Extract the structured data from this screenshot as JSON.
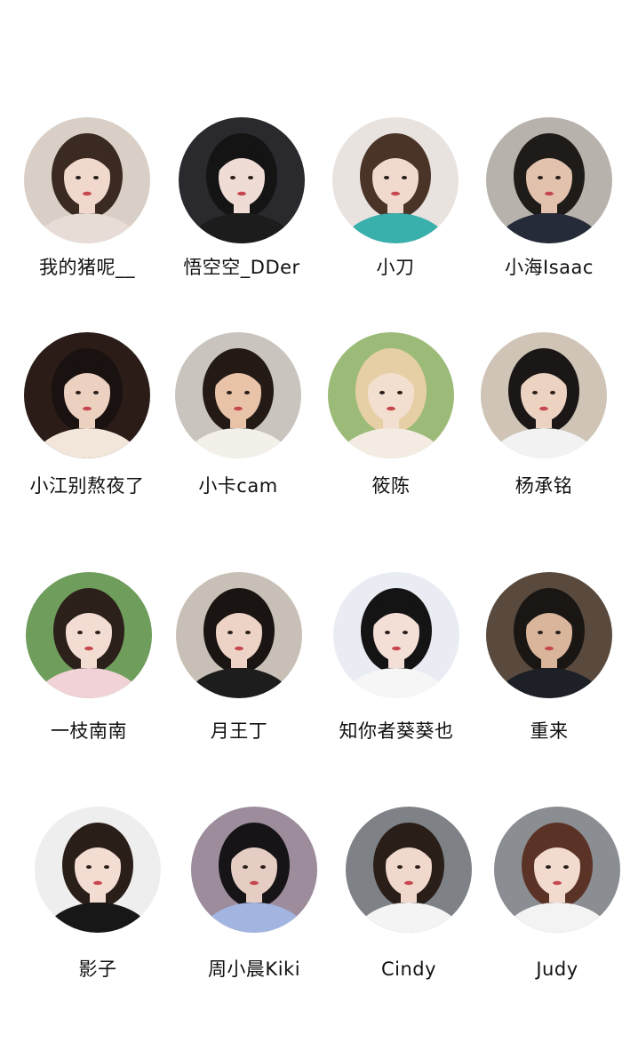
{
  "profiles": [
    {
      "name": "我的猪呢__",
      "colors": {
        "bg": "#d9cfc6",
        "hair": "#3a2a22",
        "skin": "#f1d8cc",
        "top": "#e8ddd6"
      }
    },
    {
      "name": "悟空空_DDer",
      "colors": {
        "bg": "#2a2a2e",
        "hair": "#141414",
        "skin": "#efdcd5",
        "top": "#1c1c1c"
      }
    },
    {
      "name": "小刀",
      "colors": {
        "bg": "#e9e3e0",
        "hair": "#4a3428",
        "skin": "#f2d9cf",
        "top": "#3ab0ad"
      }
    },
    {
      "name": "小海Isaac",
      "colors": {
        "bg": "#b8b2ac",
        "hair": "#1f1b19",
        "skin": "#e2c2ad",
        "top": "#262b3a"
      }
    },
    {
      "name": "小江别熬夜了",
      "colors": {
        "bg": "#2b1c18",
        "hair": "#1a1210",
        "skin": "#ecd0c0",
        "top": "#f2e6da"
      }
    },
    {
      "name": "小卡cam",
      "colors": {
        "bg": "#c9c4bd",
        "hair": "#231a16",
        "skin": "#e8c3a8",
        "top": "#f3efe9"
      }
    },
    {
      "name": "筱陈",
      "colors": {
        "bg": "#9cbb78",
        "hair": "#e7cfa5",
        "skin": "#f3dfcf",
        "top": "#f4ece2"
      }
    },
    {
      "name": "杨承铭",
      "colors": {
        "bg": "#cfc4b6",
        "hair": "#1b1717",
        "skin": "#ecd2c1",
        "top": "#f2f2f2"
      }
    },
    {
      "name": "一枝南南",
      "colors": {
        "bg": "#6f9d5c",
        "hair": "#2c201b",
        "skin": "#f3ddd2",
        "top": "#f1d2d6"
      }
    },
    {
      "name": "月王丁",
      "colors": {
        "bg": "#c8c0b6",
        "hair": "#1a1412",
        "skin": "#edd3c6",
        "top": "#1d1d1d"
      }
    },
    {
      "name": "知你者葵葵也",
      "colors": {
        "bg": "#e9ecf3",
        "hair": "#141414",
        "skin": "#f4dfd6",
        "top": "#f6f6f6"
      }
    },
    {
      "name": "重来",
      "colors": {
        "bg": "#5a4a3d",
        "hair": "#1a1613",
        "skin": "#d9b59c",
        "top": "#1d2026"
      }
    },
    {
      "name": "影子",
      "colors": {
        "bg": "#eeeeee",
        "hair": "#2a1e19",
        "skin": "#f3ddd2",
        "top": "#171717"
      }
    },
    {
      "name": "周小晨Kiki",
      "colors": {
        "bg": "#9c8c9c",
        "hair": "#161416",
        "skin": "#e5cdc3",
        "top": "#a2b5e0"
      }
    },
    {
      "name": "Cindy",
      "colors": {
        "bg": "#7e8287",
        "hair": "#2a1e19",
        "skin": "#f1d8cc",
        "top": "#f4f4f4"
      }
    },
    {
      "name": "Judy",
      "colors": {
        "bg": "#8a8d92",
        "hair": "#5b3326",
        "skin": "#f2dacf",
        "top": "#f3f3f3"
      }
    }
  ]
}
